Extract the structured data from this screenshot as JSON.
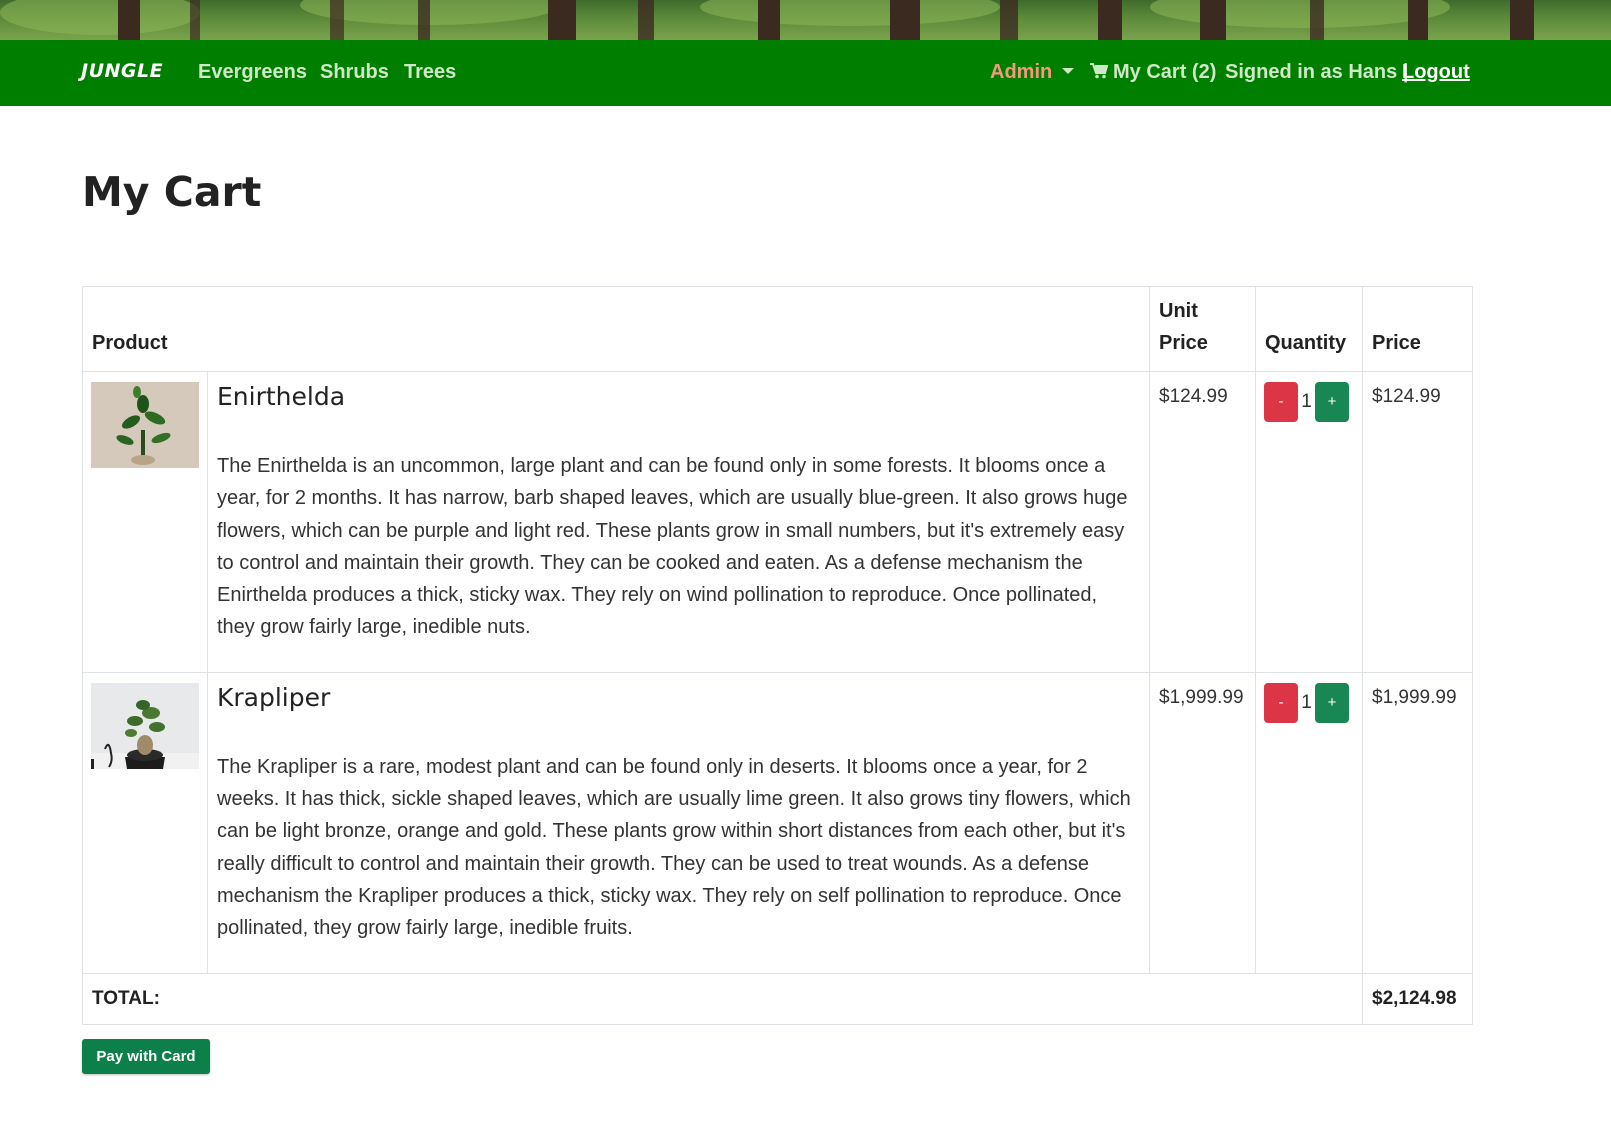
{
  "navbar": {
    "brand": "JUNGLE",
    "links": [
      "Evergreens",
      "Shrubs",
      "Trees"
    ],
    "admin_label": "Admin",
    "cart_label": "My Cart (2)",
    "signed_in_text": "Signed in as Hans |",
    "logout_label": "Logout",
    "colors": {
      "bar": "#007e00",
      "link": "#cfe8c6",
      "admin": "#f39a7e"
    }
  },
  "page": {
    "title": "My Cart"
  },
  "table": {
    "headers": {
      "product": "Product",
      "unit_price": "Unit Price",
      "quantity": "Quantity",
      "price": "Price"
    },
    "items": [
      {
        "name": "Enirthelda",
        "description": "The Enirthelda is an uncommon, large plant and can be found only in some forests. It blooms once a year, for 2 months. It has narrow, barb shaped leaves, which are usually blue-green. It also grows huge flowers, which can be purple and light red. These plants grow in small numbers, but it's extremely easy to control and maintain their growth. They can be cooked and eaten. As a defense mechanism the Enirthelda produces a thick, sticky wax. They rely on wind pollination to reproduce. Once pollinated, they grow fairly large, inedible nuts.",
        "unit_price": "$124.99",
        "quantity": "1",
        "price": "$124.99",
        "decrement_label": "-",
        "increment_label": "+"
      },
      {
        "name": "Krapliper",
        "description": "The Krapliper is a rare, modest plant and can be found only in deserts. It blooms once a year, for 2 weeks. It has thick, sickle shaped leaves, which are usually lime green. It also grows tiny flowers, which can be light bronze, orange and gold. These plants grow within short distances from each other, but it's really difficult to control and maintain their growth. They can be used to treat wounds. As a defense mechanism the Krapliper produces a thick, sticky wax. They rely on self pollination to reproduce. Once pollinated, they grow fairly large, inedible fruits.",
        "unit_price": "$1,999.99",
        "quantity": "1",
        "price": "$1,999.99",
        "decrement_label": "-",
        "increment_label": "+"
      }
    ],
    "total_label": "TOTAL:",
    "total_value": "$2,124.98"
  },
  "pay_button_label": "Pay with Card"
}
